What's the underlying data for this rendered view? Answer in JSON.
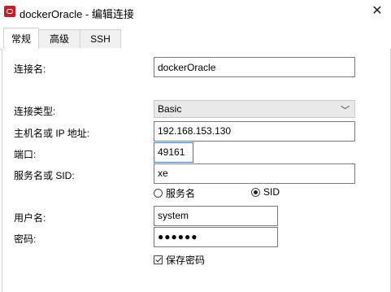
{
  "window": {
    "title": "dockerOracle - 编辑连接",
    "close_glyph": "✕",
    "icon": "oracle-icon"
  },
  "tabs": [
    {
      "label": "常规",
      "active": true
    },
    {
      "label": "高级",
      "active": false
    },
    {
      "label": "SSH",
      "active": false
    }
  ],
  "form": {
    "connection_name": {
      "label": "连接名:",
      "value": "dockerOracle"
    },
    "connection_type": {
      "label": "连接类型:",
      "value": "Basic"
    },
    "host": {
      "label": "主机名或 IP 地址:",
      "value": "192.168.153.130"
    },
    "port": {
      "label": "端口:",
      "value": "49161"
    },
    "service": {
      "label": "服务名或 SID:",
      "value": "xe"
    },
    "service_radio": {
      "service_name_label": "服务名",
      "sid_label": "SID",
      "selected": "SID"
    },
    "username": {
      "label": "用户名:",
      "value": "system"
    },
    "password": {
      "label": "密码:",
      "value": "●●●●●●"
    },
    "save_password": {
      "label": "保存密码",
      "checked": true
    }
  }
}
